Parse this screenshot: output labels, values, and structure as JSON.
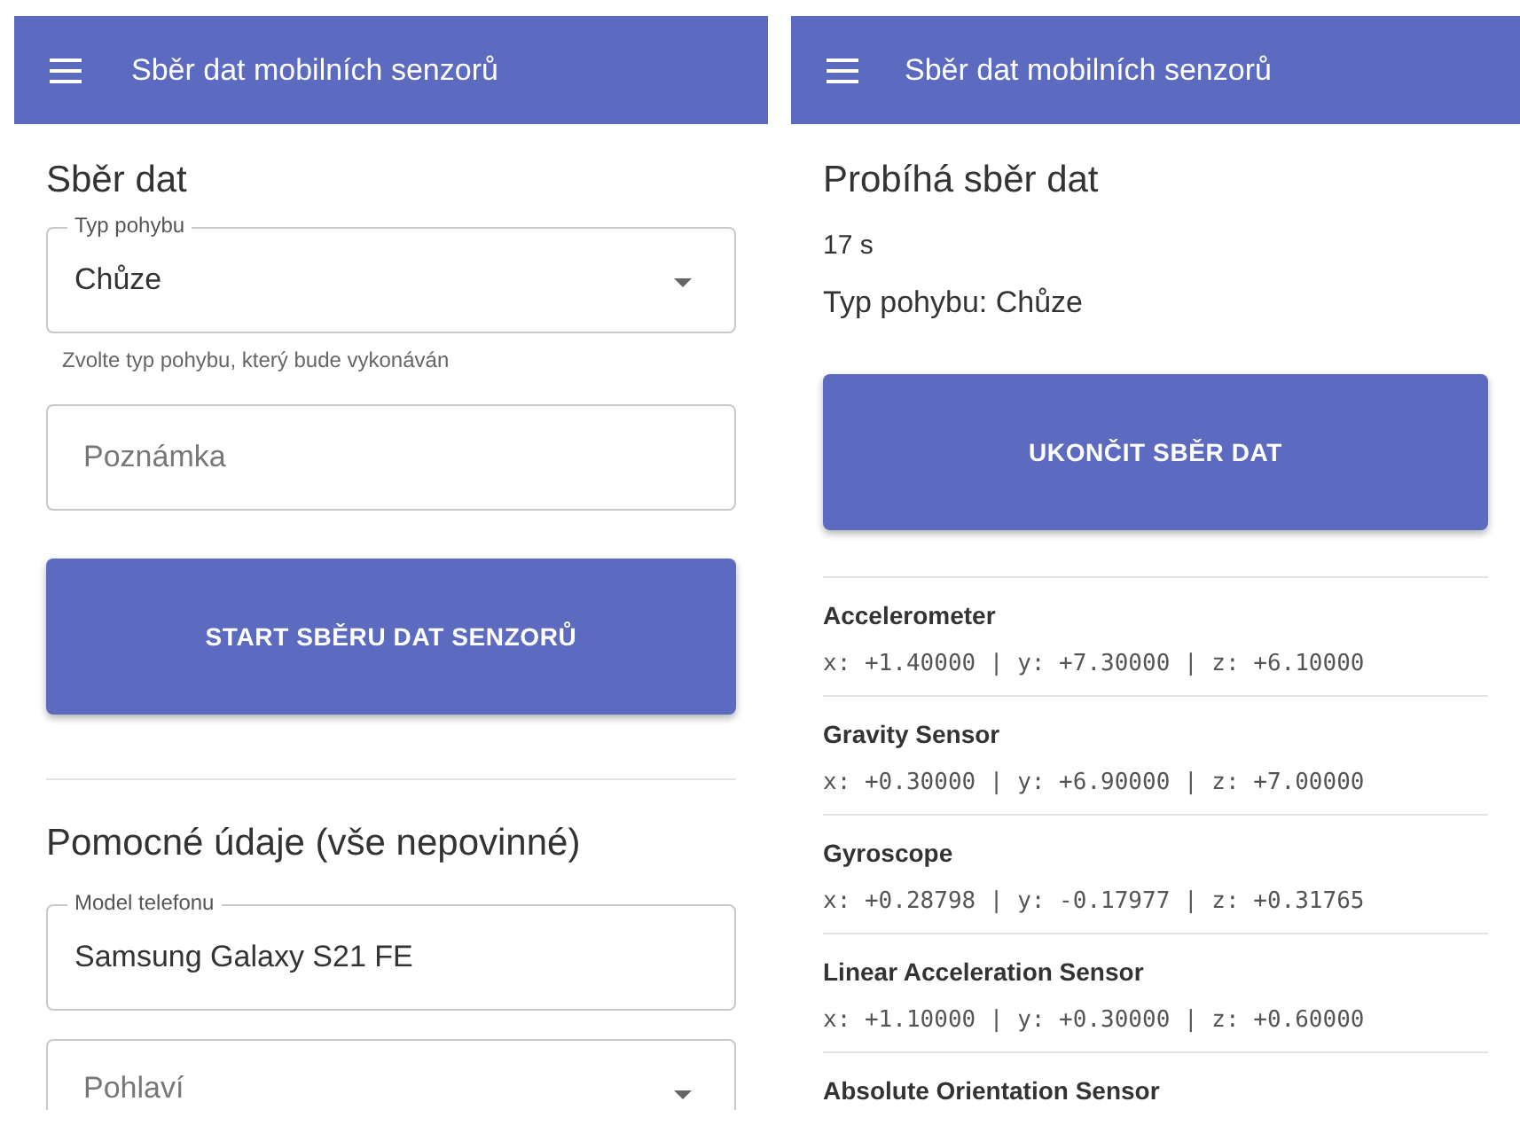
{
  "form_screen": {
    "app_bar": {
      "title": "Sběr dat mobilních senzorů"
    },
    "heading": "Sběr dat",
    "movement_select": {
      "label": "Typ pohybu",
      "value": "Chůze",
      "helper": "Zvolte typ pohybu, který bude vykonáván"
    },
    "note_field": {
      "placeholder": "Poznámka"
    },
    "start_button": "START SBĚRU DAT SENZORŮ",
    "section_heading": "Pomocné údaje (vše nepovinné)",
    "phone_model_field": {
      "label": "Model telefonu",
      "value": "Samsung Galaxy S21 FE"
    },
    "gender_select": {
      "placeholder": "Pohlaví"
    }
  },
  "recording_screen": {
    "app_bar": {
      "title": "Sběr dat mobilních senzorů"
    },
    "heading": "Probíhá sběr dat",
    "elapsed": "17 s",
    "movement": "Typ pohybu: Chůze",
    "stop_button": "UKONČIT SBĚR DAT",
    "sensors": [
      {
        "name": "Accelerometer",
        "values": "x: +1.40000 | y: +7.30000 | z: +6.10000"
      },
      {
        "name": "Gravity Sensor",
        "values": "x: +0.30000 | y: +6.90000 | z: +7.00000"
      },
      {
        "name": "Gyroscope",
        "values": "x: +0.28798 | y: -0.17977 | z: +0.31765"
      },
      {
        "name": "Linear Acceleration Sensor",
        "values": "x: +1.10000 | y: +0.30000 | z: +0.60000"
      },
      {
        "name": "Absolute Orientation Sensor"
      }
    ]
  }
}
